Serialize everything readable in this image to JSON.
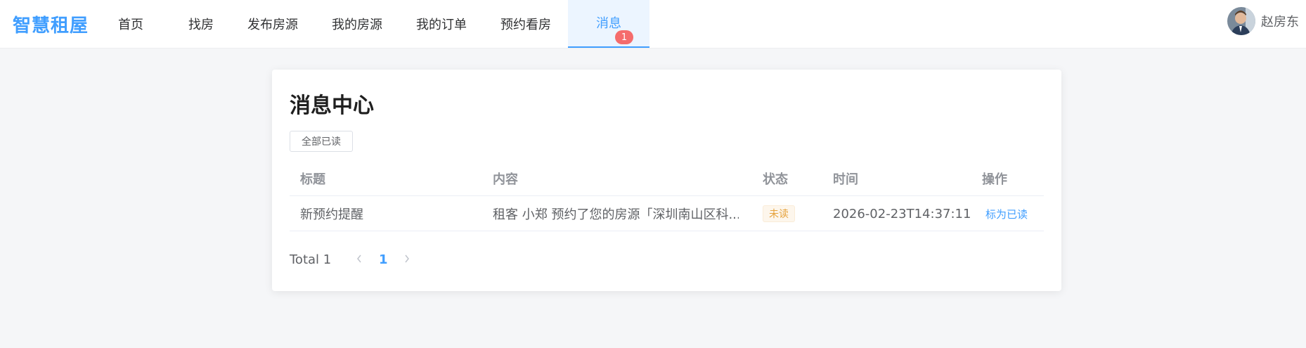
{
  "brand": {
    "name": "智慧租屋",
    "color": "#409eff"
  },
  "nav": {
    "items": [
      {
        "label": "首页"
      },
      {
        "label": "找房"
      },
      {
        "label": "发布房源"
      },
      {
        "label": "我的房源"
      },
      {
        "label": "我的订单"
      },
      {
        "label": "预约看房"
      },
      {
        "label": "消息",
        "active": true,
        "badge": "1"
      }
    ]
  },
  "user": {
    "name": "赵房东",
    "avatar_icon": "user-avatar"
  },
  "page": {
    "title": "消息中心",
    "mark_all_label": "全部已读"
  },
  "table": {
    "headers": [
      "标题",
      "内容",
      "状态",
      "时间",
      "操作"
    ],
    "rows": [
      {
        "title": "新预约提醒",
        "content": "租客 小郑 预约了您的房源「深圳南山区科...",
        "status": "未读",
        "time": "2026-02-23T14:37:11",
        "action": "标为已读"
      }
    ]
  },
  "pagination": {
    "total_label": "Total 1",
    "current_page": "1",
    "prev_icon": "chevron-left-icon",
    "next_icon": "chevron-right-icon"
  },
  "colors": {
    "accent": "#409eff",
    "badge": "#f56c6c",
    "warning": "#e6a23c",
    "background": "#f5f6f8"
  }
}
